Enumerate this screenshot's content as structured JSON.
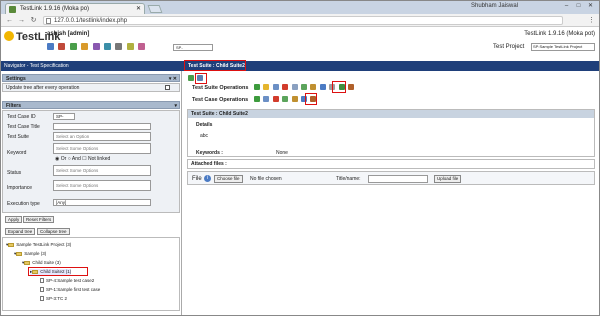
{
  "browser": {
    "tab_title": "TestLink 1.9.16 (Moka po)",
    "window_title": "Shubham Jaiswal",
    "url": "127.0.0.1/testlink/index.php"
  },
  "header": {
    "logo": "TestLink",
    "user": "ashish [admin]",
    "toolbar_select": "SP-",
    "version": "TestLink 1.9.16 (Moka pot)",
    "project_label": "Test Project",
    "project_value": "SP:Sample TestLink Project"
  },
  "nav": {
    "title": "Navigator - Test Specification"
  },
  "settings": {
    "title": "Settings",
    "update_tree_label": "Update tree after every operation"
  },
  "filters": {
    "title": "Filters",
    "testcase_id_label": "Test Case ID",
    "testcase_id_value": "SP-",
    "testcase_title_label": "Test Case Title",
    "testsuite_label": "Test Suite",
    "testsuite_placeholder": "Select an Option",
    "keyword_label": "Keyword",
    "keyword_placeholder": "Select Some Options",
    "or_label": "Or",
    "and_label": "And",
    "not_linked_label": "Not linked",
    "status_label": "Status",
    "status_placeholder": "Select Some Options",
    "importance_label": "Importance",
    "importance_placeholder": "Select Some Options",
    "exec_type_label": "Execution type",
    "exec_type_value": "[Any]",
    "apply_label": "Apply",
    "reset_label": "Reset Filters"
  },
  "tree": {
    "expand_label": "Expand tree",
    "collapse_label": "Collapse tree",
    "nodes": {
      "root": "Sample TestLink Project (3)",
      "sample": "Sample (3)",
      "child1": "Child Suite (3)",
      "child2": "Child Suite2 (1)",
      "tc1": "SP-4:Sample test case2",
      "tc2": "SP-1:Sample first test case",
      "tc3": "SP-3:TC 2"
    }
  },
  "main": {
    "tab_label": "Test Suite : Child Suite2",
    "suite_ops_label": "Test Suite Operations",
    "case_ops_label": "Test Case Operations",
    "card_title": "Test Suite : Child Suite2",
    "details_label": "Details",
    "details_value": "abc",
    "keywords_label": "Keywords :",
    "keywords_value": "None",
    "attached_label": "Attached files :",
    "file_label": "File",
    "choose_label": "Choose file",
    "no_file_label": "No file chosen",
    "title_label": "Title/name:",
    "upload_label": "Upload file"
  }
}
